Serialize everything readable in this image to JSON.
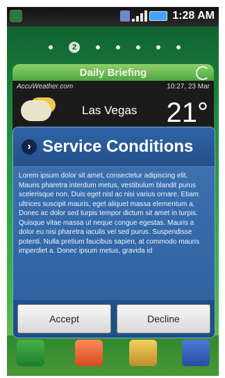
{
  "status": {
    "time": "1:28 AM"
  },
  "home": {
    "current_page": "2"
  },
  "widget": {
    "title": "Daily Briefing",
    "provider": "AccuWeather.com",
    "datetime": "10:27, 23 Mar",
    "city": "Las Vegas",
    "temperature": "21°"
  },
  "dialog": {
    "title": "Service Conditions",
    "body": "Lorem ipsum dolor sit amet, consectetur adipiscing elit. Mauris pharetra interdum metus, vestibulum blandit purus scelerisque non. Duis eget nisl ac nisi varius ornare. Etiam ultrices suscipit mauris, eget aliquet massa elementum a. Donec ac dolor sed turpis tempor dictum sit amet in turpis. Quisque vitae massa ut neque congue egestas. Mauris a dolor eu nisi pharetra iaculis vel sed purus. Suspendisse potenti. Nulla pretium faucibus sapien, at commodo mauris imperdiet a. Donec ipsum metus, gravida id",
    "accept_label": "Accept",
    "decline_label": "Decline"
  },
  "dock": {
    "icons": [
      "phone-icon",
      "contacts-icon",
      "messages-icon",
      "apps-icon"
    ]
  },
  "colors": {
    "dialog_bg": "#2b5e9e",
    "widget_header": "#4fa642",
    "home_bg": "#2ea346"
  }
}
